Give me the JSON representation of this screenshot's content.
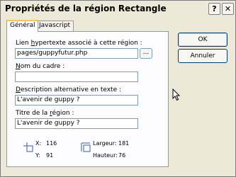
{
  "window": {
    "title": "Propriétés de la région Rectangle",
    "help_label": "?",
    "close_label": "✕"
  },
  "tabs": [
    {
      "label": "Général",
      "selected": true
    },
    {
      "label": "Javascript",
      "selected": false
    }
  ],
  "form": {
    "link_label_pre": "Lien ",
    "link_label_u": "h",
    "link_label_post": "ypertexte associé à cette région :",
    "link_value": "pages/guppyfutur.php",
    "browse_label": "...",
    "frame_label_pre": "",
    "frame_label_u": "N",
    "frame_label_post": "om du cadre :",
    "frame_value": "",
    "alt_label_pre": "",
    "alt_label_u": "D",
    "alt_label_post": "escription alternative en texte :",
    "alt_value": "L'avenir de guppy ?",
    "title_label_pre": "Titre de la ",
    "title_label_u": "r",
    "title_label_post": "égion :",
    "title_value": "L'avenir de guppy ?"
  },
  "geometry": {
    "x_label": "X:",
    "x_value": "116",
    "y_label": "Y:",
    "y_value": "91",
    "width_label": "Largeur:",
    "width_value": "181",
    "height_label": "Hauteur:",
    "height_value": "76"
  },
  "buttons": {
    "ok": "OK",
    "cancel": "Annuler"
  },
  "icons": {
    "position": "position-icon",
    "size": "size-icon",
    "cursor": "mouse-cursor-icon"
  }
}
